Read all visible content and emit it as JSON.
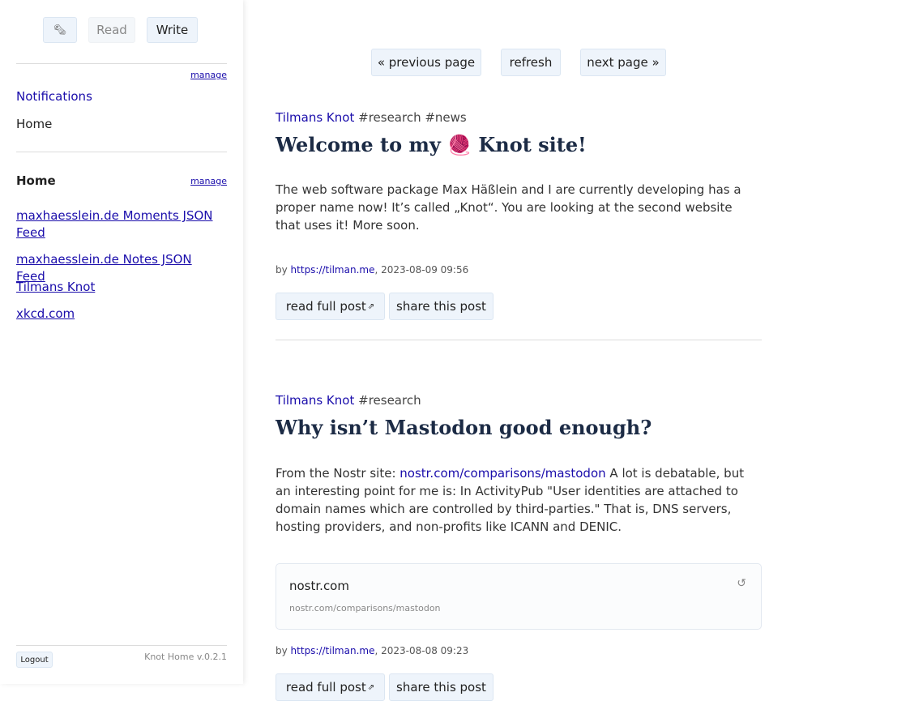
{
  "sidebar": {
    "tabs": {
      "icon": "🗞",
      "read": "Read",
      "write": "Write"
    },
    "manage_label": "manage",
    "nav": {
      "notifications": "Notifications",
      "home": "Home"
    },
    "feeds_heading": "Home",
    "feeds": [
      "maxhaesslein.de Moments JSON Feed",
      "maxhaesslein.de Notes JSON Feed",
      "Tilmans Knot",
      "xkcd.com"
    ],
    "logout": "Logout",
    "footer": {
      "home_link": "Knot Home",
      "version": "v.0.2.1"
    }
  },
  "pager": {
    "prev": "« previous page",
    "refresh": "refresh",
    "next": "next page »"
  },
  "posts": [
    {
      "author": "Tilmans Knot",
      "tags": "#research #news",
      "title": "Welcome to my 🧶 Knot site!",
      "body": "The web software package Max Häßlein and I are currently developing has a proper name now! It’s called „Knot“. You are looking at the second website that uses it! More soon.",
      "by_prefix": "by",
      "by_link": "https://tilman.me",
      "date": ", 2023-08-09 09:56",
      "read_label": "read full post",
      "share_label": "share this post"
    },
    {
      "author": "Tilmans Knot",
      "tags": "#research",
      "title": "Why isn’t Mastodon good enough?",
      "body_prefix": "From the Nostr site: ",
      "body_link": "nostr.com/comparisons/mastodon",
      "body_suffix": " A lot is debatable, but an interesting point for me is: In ActivityPub \"User identities are attached to domain names which are controlled by third-parties.\" That is, DNS servers, hosting providers, and non-profits like ICANN and DENIC.",
      "card_title": "nostr.com",
      "card_url": "nostr.com/comparisons/mastodon",
      "card_refresh_icon": "↺",
      "by_prefix": "by",
      "by_link": "https://tilman.me",
      "date": ", 2023-08-08 09:23",
      "read_label": "read full post",
      "share_label": "share this post"
    }
  ],
  "icons": {
    "external_link": "⇗"
  },
  "colors": {
    "link": "#1a0dab",
    "title": "#1c2b45",
    "button_bg": "#eef4fb"
  }
}
